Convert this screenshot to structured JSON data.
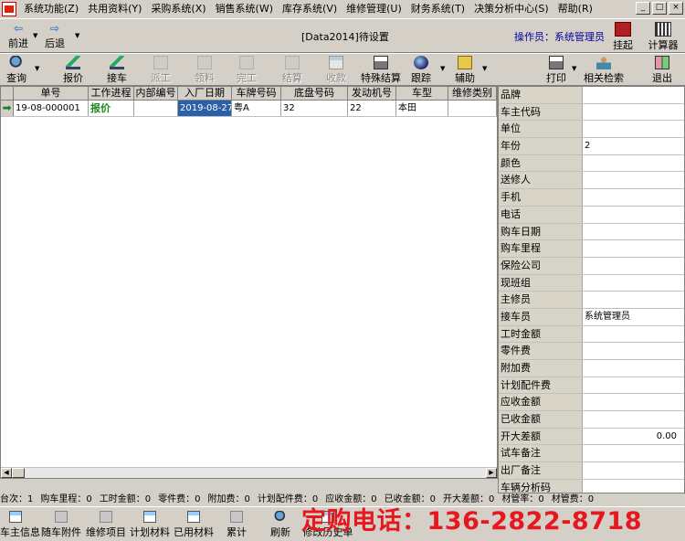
{
  "menubar": {
    "items": [
      "系统功能(Z)",
      "共用资料(Y)",
      "采购系统(X)",
      "销售系统(W)",
      "库存系统(V)",
      "维修管理(U)",
      "财务系统(T)",
      "决策分析中心(S)",
      "帮助(R)"
    ],
    "window_buttons": [
      "_",
      "□",
      "×"
    ]
  },
  "toolbar1": {
    "prev_label": "前进",
    "back_label": "后退",
    "title": "[Data2014]待设置",
    "operator": "操作员：系统管理员",
    "hang_label": "挂起",
    "calculator_label": "计算器"
  },
  "toolbar2": {
    "tools": [
      {
        "label": "查询",
        "icon": "search-icon",
        "enabled": true
      },
      {
        "label": "报价",
        "icon": "quote-icon",
        "enabled": true
      },
      {
        "label": "接车",
        "icon": "receive-car-icon",
        "enabled": true
      },
      {
        "label": "派工",
        "icon": "dispatch-icon",
        "enabled": false
      },
      {
        "label": "领料",
        "icon": "pick-material-icon",
        "enabled": false
      },
      {
        "label": "完工",
        "icon": "complete-icon",
        "enabled": false
      },
      {
        "label": "结算",
        "icon": "settle-icon",
        "enabled": false
      },
      {
        "label": "收款",
        "icon": "receipt-icon",
        "enabled": false
      },
      {
        "label": "特殊结算",
        "icon": "printer-icon",
        "enabled": true
      },
      {
        "label": "跟踪",
        "icon": "globe-icon",
        "enabled": true
      },
      {
        "label": "辅助",
        "icon": "folder-icon",
        "enabled": true
      },
      {
        "label": "打印",
        "icon": "printer-icon",
        "enabled": true
      },
      {
        "label": "相关检索",
        "icon": "person-search-icon",
        "enabled": true
      },
      {
        "label": "退出",
        "icon": "exit-icon",
        "enabled": true
      }
    ]
  },
  "grid": {
    "columns": [
      "单号",
      "工作进程",
      "内部编号",
      "入厂日期",
      "车牌号码",
      "底盘号码",
      "发动机号",
      "车型",
      "维修类别"
    ],
    "rows": [
      {
        "order_no": "19-08-000001",
        "progress": "报价",
        "internal_no": "",
        "entry_date": "2019-08-27",
        "plate": "粤A",
        "chassis": "32",
        "engine": "22",
        "model": "本田",
        "repair_type": ""
      }
    ]
  },
  "properties": [
    {
      "label": "品牌",
      "value": ""
    },
    {
      "label": "车主代码",
      "value": ""
    },
    {
      "label": "单位",
      "value": ""
    },
    {
      "label": "年份",
      "value": "2"
    },
    {
      "label": "颜色",
      "value": ""
    },
    {
      "label": "送修人",
      "value": ""
    },
    {
      "label": "手机",
      "value": ""
    },
    {
      "label": "电话",
      "value": ""
    },
    {
      "label": "购车日期",
      "value": ""
    },
    {
      "label": "购车里程",
      "value": ""
    },
    {
      "label": "保险公司",
      "value": ""
    },
    {
      "label": "现班组",
      "value": ""
    },
    {
      "label": "主修员",
      "value": ""
    },
    {
      "label": "接车员",
      "value": "系统管理员"
    },
    {
      "label": "工时金额",
      "value": ""
    },
    {
      "label": "零件费",
      "value": ""
    },
    {
      "label": "附加费",
      "value": ""
    },
    {
      "label": "计划配件费",
      "value": ""
    },
    {
      "label": "应收金额",
      "value": ""
    },
    {
      "label": "已收金额",
      "value": ""
    },
    {
      "label": "开大差额",
      "value": "0.00"
    },
    {
      "label": "试车备注",
      "value": ""
    },
    {
      "label": "出厂备注",
      "value": ""
    },
    {
      "label": "车辆分析码",
      "value": ""
    }
  ],
  "statusbar": [
    "台次：1",
    "购车里程：0",
    "工时金额：0",
    "零件费：0",
    "附加费：0",
    "计划配件费：0",
    "应收金额：0",
    "已收金额：0",
    "开大差额：0",
    "材管率：0",
    "材管费：0"
  ],
  "bottombar": {
    "buttons": [
      "车主信息",
      "随车附件",
      "维修项目",
      "计划材料",
      "已用材料",
      "累计",
      "刷新",
      "修改历史单"
    ]
  },
  "advert": "定购电话：136-2822-8718",
  "colors": {
    "progress_status": "#1b8a1b",
    "selection": "#2b5fa8",
    "advert": "#e8171d",
    "operator": "#0000a0"
  }
}
